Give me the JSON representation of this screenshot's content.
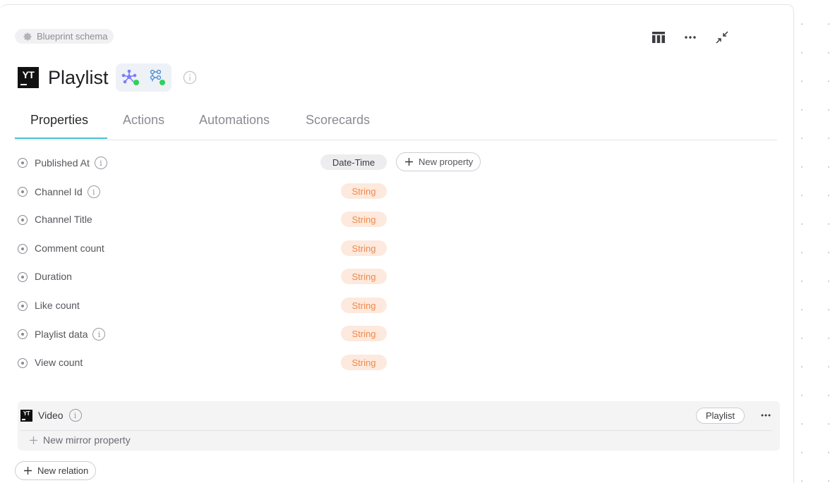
{
  "header": {
    "schema_chip": "Blueprint schema",
    "title": "Playlist",
    "logo_text": "YT",
    "actions": [
      "table-icon",
      "more-icon",
      "collapse-icon"
    ]
  },
  "tabs": [
    {
      "label": "Properties",
      "active": true
    },
    {
      "label": "Actions"
    },
    {
      "label": "Automations"
    },
    {
      "label": "Scorecards"
    }
  ],
  "new_property_label": "New property",
  "properties": [
    {
      "name": "Published At",
      "type": "Date-Time",
      "info": true
    },
    {
      "name": "Channel Id",
      "type": "String",
      "info": true
    },
    {
      "name": "Channel Title",
      "type": "String"
    },
    {
      "name": "Comment count",
      "type": "String"
    },
    {
      "name": "Duration",
      "type": "String"
    },
    {
      "name": "Like count",
      "type": "String"
    },
    {
      "name": "Playlist data",
      "type": "String",
      "info": true
    },
    {
      "name": "View count",
      "type": "String"
    }
  ],
  "relation": {
    "name": "Video",
    "target": "Playlist",
    "new_mirror_label": "New mirror property"
  },
  "new_relation_label": "New relation",
  "colors": {
    "accent": "#49c1d2",
    "string_badge_bg": "#fde9dd",
    "string_badge_text": "#f08a4b"
  }
}
